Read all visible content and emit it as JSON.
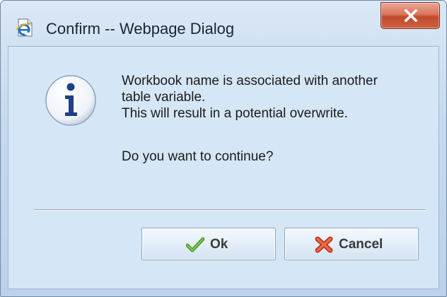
{
  "window": {
    "title": "Confirm -- Webpage Dialog",
    "close_label": "X"
  },
  "message": {
    "lines": [
      "Workbook name is associated with another",
      "table variable.",
      "This will result in a potential overwrite."
    ],
    "question": "Do you want to continue?"
  },
  "buttons": {
    "ok_label": "Ok",
    "cancel_label": "Cancel"
  },
  "icons": {
    "title": "ie-page-icon",
    "message": "info-icon",
    "ok": "checkmark-icon",
    "cancel": "cross-icon",
    "close": "close-icon"
  },
  "colors": {
    "close_button": "#d0593a",
    "dialog_background": "#d5e6f6",
    "ok_icon": "#4f9a2c",
    "cancel_icon": "#d84a2a",
    "info_icon": "#1f3f86"
  }
}
